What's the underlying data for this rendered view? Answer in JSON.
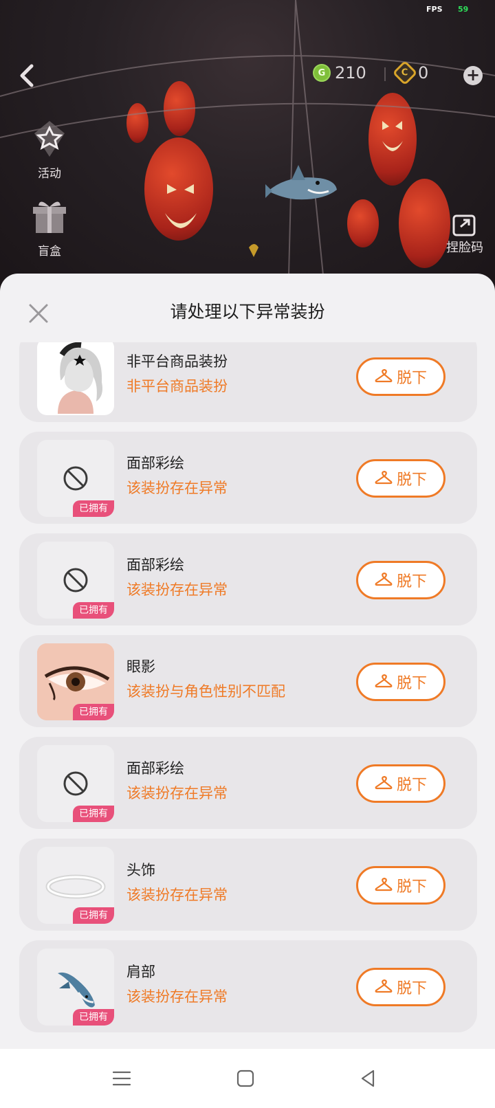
{
  "hud": {
    "fps_label": "FPS",
    "fps_value": "59",
    "gems": "210",
    "coins": "0",
    "gem_icon_letter": "G",
    "coin_icon_letter": "C"
  },
  "side_menu": {
    "activity": "活动",
    "blind_box": "盲盒",
    "face_code": "捏脸码"
  },
  "modal": {
    "title": "请处理以下异常装扮",
    "owned_badge": "已拥有",
    "remove_label": "脱下",
    "items": [
      {
        "name": "非平台商品装扮",
        "status": "非平台商品装扮",
        "thumb": "hair-avatar",
        "owned": false
      },
      {
        "name": "面部彩绘",
        "status": "该装扮存在异常",
        "thumb": "prohibited-icon",
        "owned": true
      },
      {
        "name": "面部彩绘",
        "status": "该装扮存在异常",
        "thumb": "prohibited-icon",
        "owned": true
      },
      {
        "name": "眼影",
        "status": "该装扮与角色性别不匹配",
        "thumb": "eye-shadow",
        "owned": true
      },
      {
        "name": "面部彩绘",
        "status": "该装扮存在异常",
        "thumb": "prohibited-icon",
        "owned": true
      },
      {
        "name": "头饰",
        "status": "该装扮存在异常",
        "thumb": "halo-ring",
        "owned": true
      },
      {
        "name": "肩部",
        "status": "该装扮存在异常",
        "thumb": "shark",
        "owned": true
      }
    ]
  },
  "colors": {
    "accent_orange": "#ef7a26",
    "owned_pink": "#e8507a",
    "modal_bg": "#f2f1f3",
    "card_bg": "#e8e6e9"
  }
}
